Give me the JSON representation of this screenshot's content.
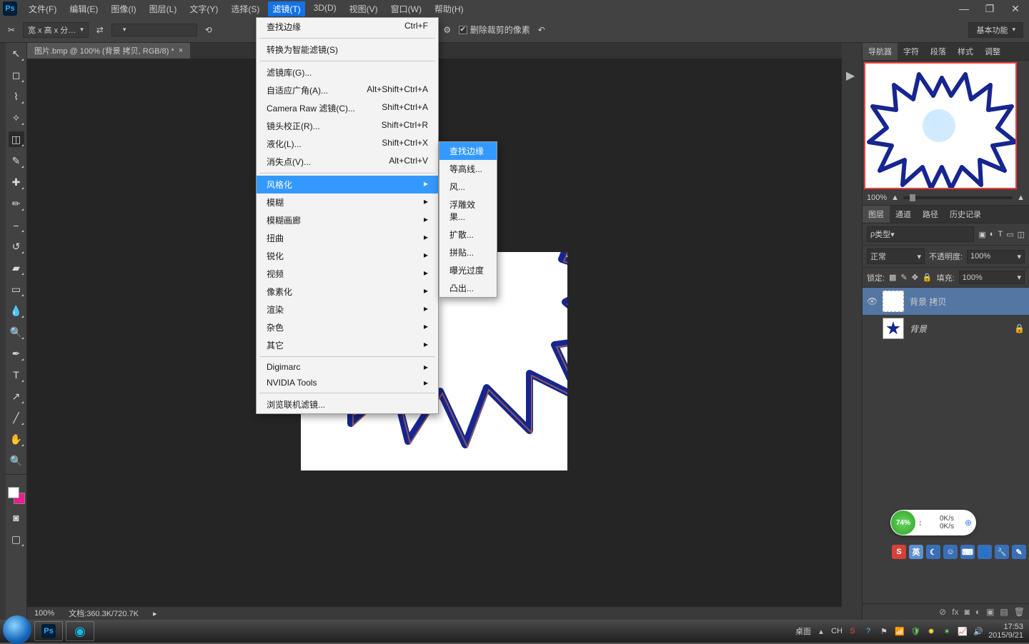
{
  "menubar": {
    "items": [
      "文件(F)",
      "编辑(E)",
      "图像(I)",
      "图层(L)",
      "文字(Y)",
      "选择(S)",
      "滤镜(T)",
      "3D(D)",
      "视图(V)",
      "窗口(W)",
      "帮助(H)"
    ],
    "active_index": 6
  },
  "optionsbar": {
    "ratio": "宽 x 高 x 分…",
    "checkbox_label": "删除裁剪的像素",
    "panel_dd": "基本功能"
  },
  "doc": {
    "tab_title": "图片.bmp @ 100% (背景 拷贝, RGB/8) *",
    "status_zoom": "100%",
    "status_doc": "文档:360.3K/720.7K"
  },
  "filter_menu": {
    "items": [
      {
        "label": "查找边缘",
        "shortcut": "Ctrl+F",
        "sep_after": true
      },
      {
        "label": "转换为智能滤镜(S)",
        "sep_after": true
      },
      {
        "label": "滤镜库(G)..."
      },
      {
        "label": "自适应广角(A)...",
        "shortcut": "Alt+Shift+Ctrl+A"
      },
      {
        "label": "Camera Raw 滤镜(C)...",
        "shortcut": "Shift+Ctrl+A"
      },
      {
        "label": "镜头校正(R)...",
        "shortcut": "Shift+Ctrl+R"
      },
      {
        "label": "液化(L)...",
        "shortcut": "Shift+Ctrl+X"
      },
      {
        "label": "消失点(V)...",
        "shortcut": "Alt+Ctrl+V",
        "sep_after": true
      },
      {
        "label": "风格化",
        "arrow": true,
        "highlighted": true
      },
      {
        "label": "模糊",
        "arrow": true
      },
      {
        "label": "模糊画廊",
        "arrow": true
      },
      {
        "label": "扭曲",
        "arrow": true
      },
      {
        "label": "锐化",
        "arrow": true
      },
      {
        "label": "视频",
        "arrow": true
      },
      {
        "label": "像素化",
        "arrow": true
      },
      {
        "label": "渲染",
        "arrow": true
      },
      {
        "label": "杂色",
        "arrow": true
      },
      {
        "label": "其它",
        "arrow": true,
        "sep_after": true
      },
      {
        "label": "Digimarc",
        "arrow": true
      },
      {
        "label": "NVIDIA Tools",
        "arrow": true,
        "sep_after": true
      },
      {
        "label": "浏览联机滤镜..."
      }
    ]
  },
  "stylize_submenu": [
    {
      "label": "查找边缘",
      "highlighted": true
    },
    {
      "label": "等高线..."
    },
    {
      "label": "风..."
    },
    {
      "label": "浮雕效果..."
    },
    {
      "label": "扩散..."
    },
    {
      "label": "拼贴..."
    },
    {
      "label": "曝光过度"
    },
    {
      "label": "凸出..."
    }
  ],
  "navigator": {
    "tabs": [
      "导航器",
      "字符",
      "段落",
      "样式",
      "调整"
    ],
    "zoom": "100%"
  },
  "layers_panel": {
    "tabs": [
      "图层",
      "通道",
      "路径",
      "历史记录"
    ],
    "kind_label": "类型",
    "blend": "正常",
    "opacity_label": "不透明度:",
    "opacity": "100%",
    "lock_label": "锁定:",
    "fill_label": "填充:",
    "fill": "100%",
    "layers": [
      {
        "name": "背景 拷贝",
        "visible": true,
        "selected": true,
        "thumb": "dotted"
      },
      {
        "name": "背景",
        "visible": false,
        "selected": false,
        "thumb": "shape",
        "locked": true
      }
    ]
  },
  "widget": {
    "percent": "74%",
    "up": "0K/s",
    "down": "0K/s"
  },
  "taskbar": {
    "desktop_label": "桌面",
    "lang": "CH",
    "time": "17:53",
    "date": "2015/9/21"
  },
  "ime": {
    "button": "S",
    "lang": "英"
  },
  "colors": {
    "accent": "#1473e6"
  }
}
